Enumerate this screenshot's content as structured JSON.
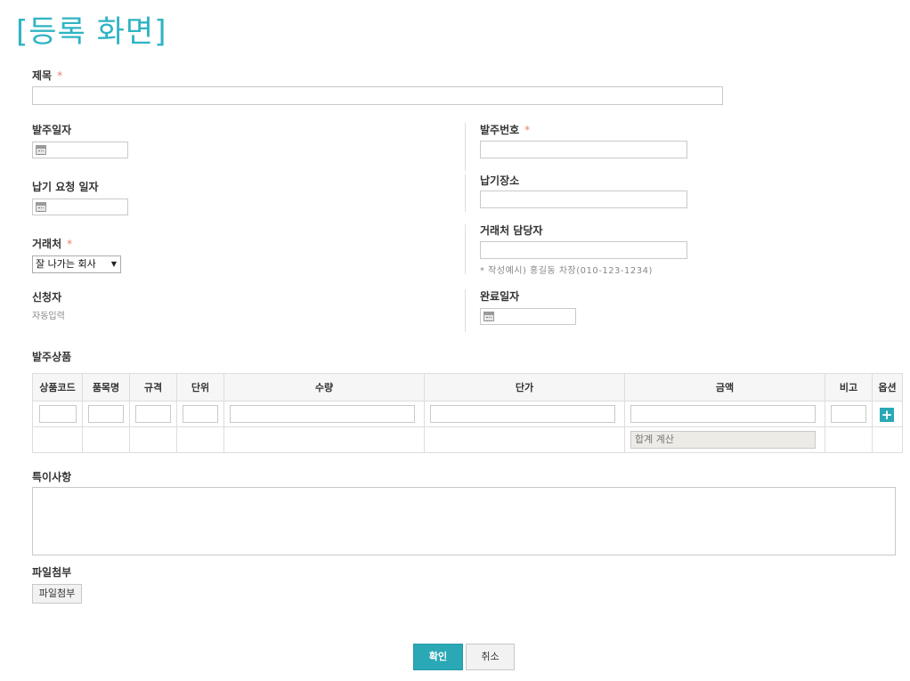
{
  "page": {
    "title": "[등록 화면]"
  },
  "form": {
    "title_label": "제목",
    "order_date_label": "발주일자",
    "order_no_label": "발주번호",
    "delivery_request_label": "납기 요청 일자",
    "delivery_place_label": "납기장소",
    "client_label": "거래처",
    "client_selected": "잘 나가는 회사",
    "client_manager_label": "거래처 담당자",
    "client_manager_hint": "* 작성예시) 홍길동 차장(010-123-1234)",
    "requester_label": "신청자",
    "requester_value": "자동입력",
    "complete_date_label": "완료일자",
    "required_mark": "*"
  },
  "items": {
    "section_label": "발주상품",
    "columns": [
      "상품코드",
      "품목명",
      "규격",
      "단위",
      "수량",
      "단가",
      "금액",
      "비고",
      "옵션"
    ],
    "sum_placeholder": "합계 계산",
    "add_icon": "+"
  },
  "notes": {
    "label": "특이사항"
  },
  "attach": {
    "label": "파일첨부",
    "button": "파일첨부"
  },
  "actions": {
    "confirm": "확인",
    "cancel": "취소"
  },
  "colors": {
    "accent": "#2eb4c3",
    "required": "#e8816a"
  }
}
